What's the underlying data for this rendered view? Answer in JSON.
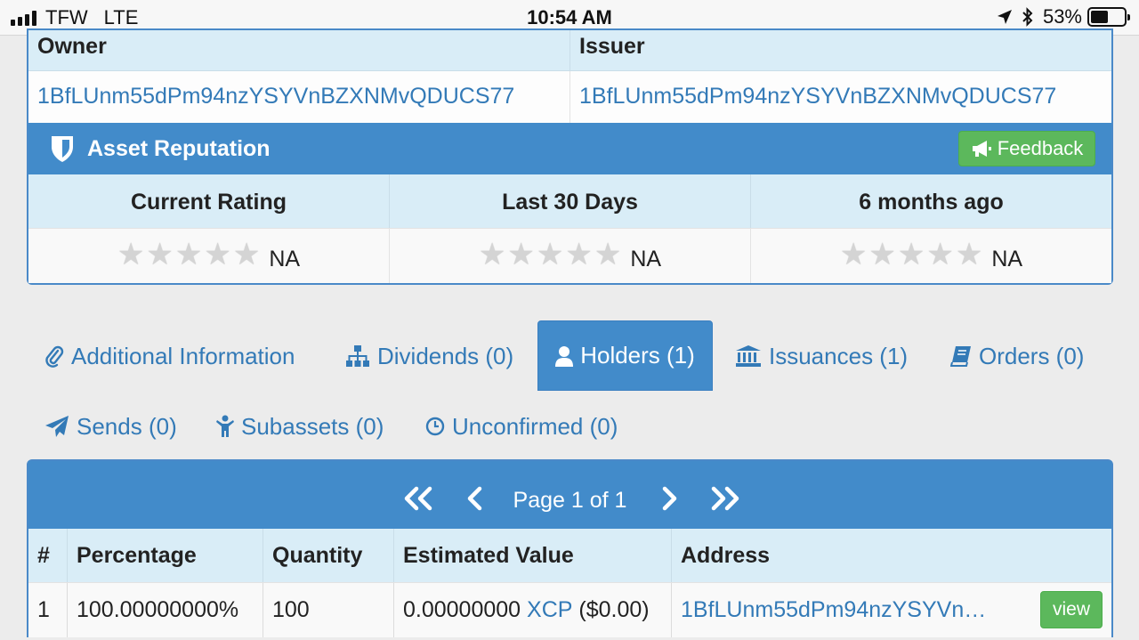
{
  "status_bar": {
    "carrier": "TFW",
    "network": "LTE",
    "time": "10:54 AM",
    "battery": "53%",
    "battery_level": 0.53,
    "icons": [
      "signal-bars-icon",
      "location-arrow-icon",
      "bluetooth-icon",
      "battery-icon"
    ]
  },
  "ownership": {
    "headers": {
      "owner": "Owner",
      "issuer": "Issuer"
    },
    "owner_address": "1BfLUnm55dPm94nzYSYVnBZXNMvQDUCS77",
    "issuer_address": "1BfLUnm55dPm94nzYSYVnBZXNMvQDUCS77"
  },
  "reputation": {
    "title": "Asset Reputation",
    "feedback_label": "Feedback",
    "columns": [
      "Current Rating",
      "Last 30 Days",
      "6 months ago"
    ],
    "ratings": [
      "NA",
      "NA",
      "NA"
    ],
    "stars_filled": [
      0,
      0,
      0
    ],
    "stars_total": 5
  },
  "tabs": [
    {
      "label": "Additional Information",
      "icon": "paperclip-icon",
      "active": false
    },
    {
      "label": "Dividends (0)",
      "icon": "sitemap-icon",
      "active": false
    },
    {
      "label": "Holders (1)",
      "icon": "user-icon",
      "active": true
    },
    {
      "label": "Issuances (1)",
      "icon": "bank-icon",
      "active": false
    },
    {
      "label": "Orders (0)",
      "icon": "book-icon",
      "active": false
    },
    {
      "label": "Sends (0)",
      "icon": "paper-plane-icon",
      "active": false
    },
    {
      "label": "Subassets (0)",
      "icon": "child-icon",
      "active": false
    },
    {
      "label": "Unconfirmed (0)",
      "icon": "clock-icon",
      "active": false
    }
  ],
  "holders": {
    "pager": {
      "text": "Page 1 of 1"
    },
    "columns": [
      "#",
      "Percentage",
      "Quantity",
      "Estimated Value",
      "Address"
    ],
    "rows": [
      {
        "index": "1",
        "percentage": "100.00000000%",
        "quantity": "100",
        "value_amount": "0.00000000",
        "value_asset": "XCP",
        "value_usd": "($0.00)",
        "address": "1BfLUnm55dPm94nzYSYVn…",
        "action_label": "view"
      }
    ]
  },
  "colors": {
    "primary": "#428bca",
    "link": "#337ab7",
    "success": "#5cb85c",
    "table_header": "#d9edf7"
  }
}
